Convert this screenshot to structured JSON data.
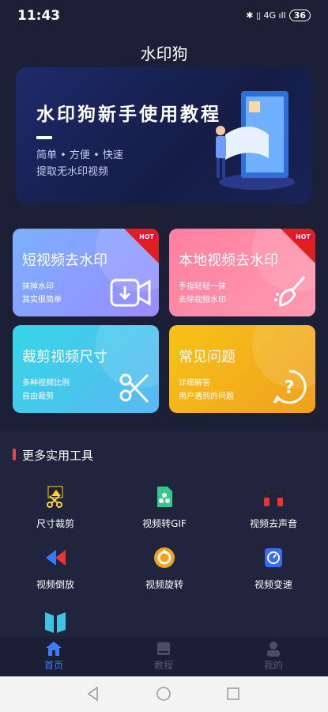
{
  "status_bar": {
    "time": "11:43",
    "icons": "✱ ▯ 4G ıll",
    "battery": "36"
  },
  "app": {
    "title": "水印狗"
  },
  "banner": {
    "title": "水印狗新手使用教程",
    "line1": "简单 • 方便 • 快速",
    "line2": "提取无水印视频"
  },
  "cards": [
    {
      "title": "短视频去水印",
      "line1": "抹掉水印",
      "line2": "其实很简单",
      "badge": "HOT",
      "icon": "video-download-icon",
      "color_from": "#7ab1ff",
      "color_to": "#9a8bff"
    },
    {
      "title": "本地视频去水印",
      "line1": "手指轻轻一抹",
      "line2": "去除视频水印",
      "badge": "HOT",
      "icon": "brush-icon",
      "color_from": "#ff7fa0",
      "color_to": "#ff9ab0"
    },
    {
      "title": "裁剪视频尺寸",
      "line1": "多种视频比例",
      "line2": "自由裁剪",
      "icon": "scissors-icon",
      "color_from": "#35d6e6",
      "color_to": "#5ab8f2"
    },
    {
      "title": "常见问题",
      "line1": "详细解答",
      "line2": "用户遇到的问题",
      "icon": "question-icon",
      "color_from": "#f7c316",
      "color_to": "#f0a020"
    }
  ],
  "tools": {
    "heading": "更多实用工具",
    "items": [
      {
        "label": "尺寸裁剪",
        "icon": "crop-icon"
      },
      {
        "label": "视频转GIF",
        "icon": "gif-icon"
      },
      {
        "label": "视频去声音",
        "icon": "headphones-icon"
      },
      {
        "label": "视频倒放",
        "icon": "rewind-icon"
      },
      {
        "label": "视频旋转",
        "icon": "rotate-icon"
      },
      {
        "label": "视频变速",
        "icon": "speed-icon"
      },
      {
        "label": "",
        "icon": "book-icon"
      }
    ]
  },
  "tabbar": [
    {
      "label": "首页",
      "icon": "home-icon",
      "active": true
    },
    {
      "label": "教程",
      "icon": "tutorial-icon"
    },
    {
      "label": "我的",
      "icon": "profile-icon"
    }
  ]
}
